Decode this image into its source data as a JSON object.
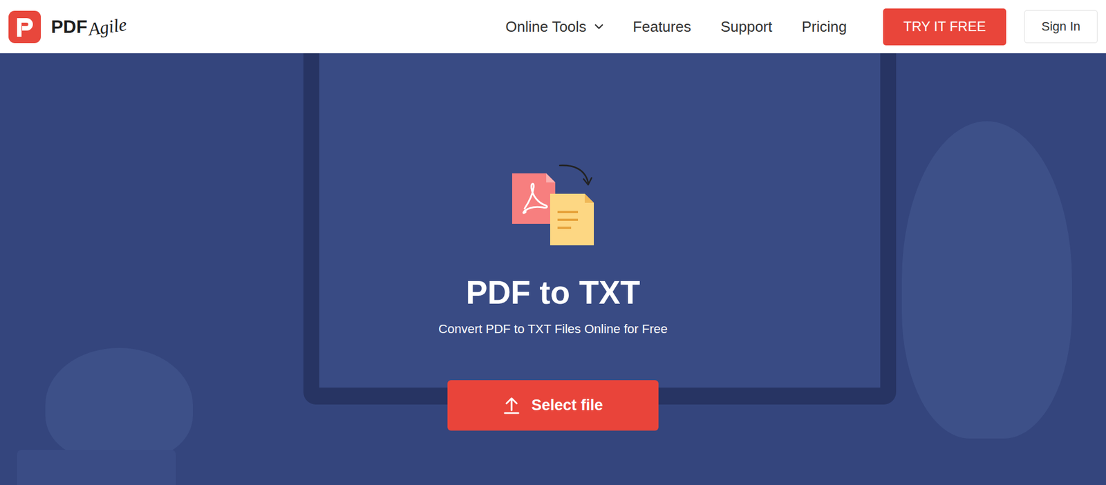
{
  "logo": {
    "brand": "PDF",
    "script": "Agile"
  },
  "nav": {
    "items": [
      {
        "label": "Online Tools",
        "dropdown": true
      },
      {
        "label": "Features",
        "dropdown": false
      },
      {
        "label": "Support",
        "dropdown": false
      },
      {
        "label": "Pricing",
        "dropdown": false
      }
    ],
    "cta": "TRY IT FREE",
    "sign_in": "Sign In"
  },
  "hero": {
    "title": "PDF to TXT",
    "subtitle": "Convert PDF to TXT Files Online for Free",
    "button": "Select file"
  }
}
